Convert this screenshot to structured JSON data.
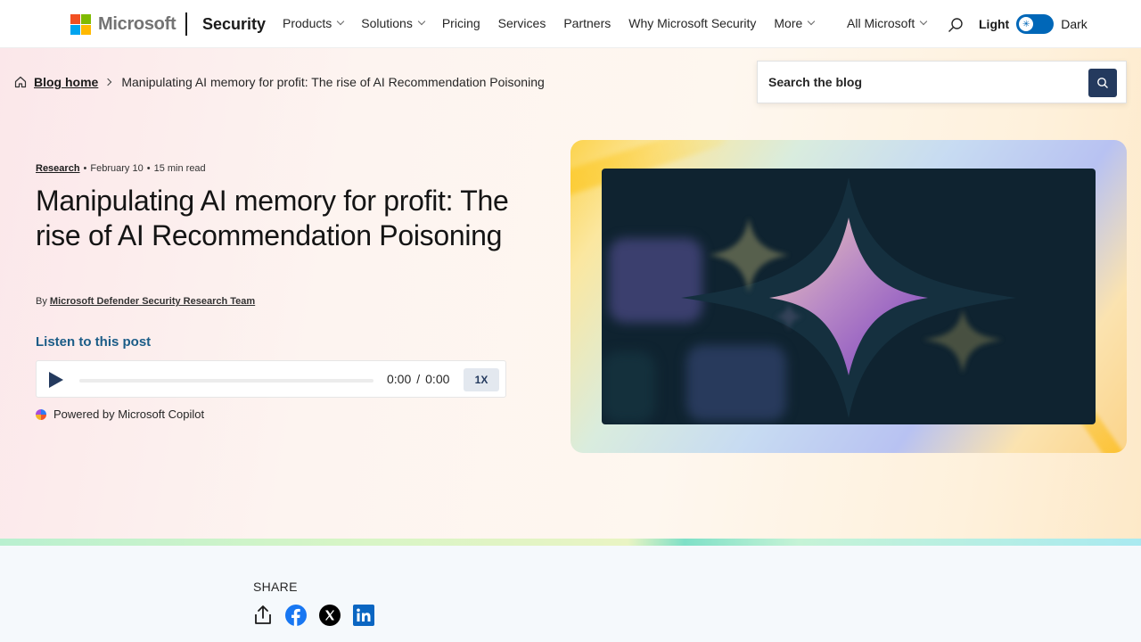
{
  "header": {
    "brand_word": "Microsoft",
    "section": "Security",
    "nav": [
      {
        "label": "Products",
        "dropdown": true
      },
      {
        "label": "Solutions",
        "dropdown": true
      },
      {
        "label": "Pricing",
        "dropdown": false
      },
      {
        "label": "Services",
        "dropdown": false
      },
      {
        "label": "Partners",
        "dropdown": false
      },
      {
        "label": "Why Microsoft Security",
        "dropdown": false
      },
      {
        "label": "More",
        "dropdown": true
      }
    ],
    "all_microsoft": "All Microsoft",
    "theme_light": "Light",
    "theme_dark": "Dark",
    "logo_colors": [
      "#f25022",
      "#7fba00",
      "#00a4ef",
      "#ffb900"
    ]
  },
  "breadcrumb": {
    "home": "Blog home",
    "current": "Manipulating AI memory for profit: The rise of AI Recommendation Poisoning"
  },
  "blog_search": {
    "placeholder": "Search the blog"
  },
  "post": {
    "category": "Research",
    "date": "February 10",
    "read_time": "15 min read",
    "title": "Manipulating AI memory for profit: The rise of AI Recommendation Poisoning",
    "by": "By",
    "author": "Microsoft Defender Security Research Team",
    "listen_label": "Listen to this post",
    "player": {
      "current": "0:00",
      "separator": "/",
      "duration": "0:00",
      "speed": "1X"
    },
    "powered_by": "Powered by Microsoft Copilot"
  },
  "share": {
    "label": "SHARE",
    "icons": [
      "share-icon",
      "facebook-icon",
      "x-icon",
      "linkedin-icon"
    ]
  },
  "colors": {
    "accent_navy": "#243a5e",
    "toggle_blue": "#0067b8",
    "listen_blue": "#1b5c87"
  }
}
